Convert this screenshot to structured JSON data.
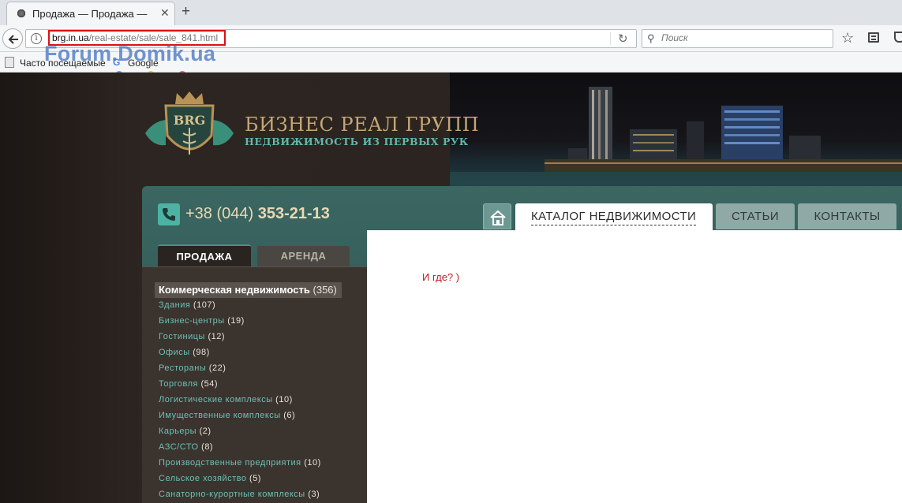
{
  "browser": {
    "tab_title": "Продажа — Продажа — Кат",
    "url_domain": "brg.in.ua",
    "url_path": "/real-estate/sale/sale_841.html",
    "search_placeholder": "Поиск",
    "bookmarks": [
      {
        "label": "Часто посещаемые"
      },
      {
        "label": "Google"
      }
    ],
    "watermark": "Forum.Domik.ua"
  },
  "site": {
    "emblem_text": "BRG",
    "name": "БИЗНЕС РЕАЛ ГРУПП",
    "tagline": "НЕДВИЖИМОСТЬ ИЗ ПЕРВЫХ РУК",
    "phone_prefix": "+38 (044)",
    "phone_number": "353-21-13",
    "sidebar_tabs": {
      "sale": "ПРОДАЖА",
      "rent": "АРЕНДА"
    },
    "nav": {
      "catalog": "КАТАЛОГ НЕДВИЖИМОСТИ",
      "articles": "СТАТЬИ",
      "contacts": "КОНТАКТЫ"
    },
    "category_head": {
      "name": "Коммерческая недвижимость",
      "count": "(356)"
    },
    "categories": [
      {
        "name": "Здания",
        "count": "(107)"
      },
      {
        "name": "Бизнес-центры",
        "count": "(19)"
      },
      {
        "name": "Гостиницы",
        "count": "(12)"
      },
      {
        "name": "Офисы",
        "count": "(98)"
      },
      {
        "name": "Рестораны",
        "count": "(22)"
      },
      {
        "name": "Торговля",
        "count": "(54)"
      },
      {
        "name": "Логистические комплексы",
        "count": "(10)"
      },
      {
        "name": "Имущественные комплексы",
        "count": "(6)"
      },
      {
        "name": "Карьеры",
        "count": "(2)"
      },
      {
        "name": "АЗС/СТО",
        "count": "(8)"
      },
      {
        "name": "Производственные предприятия",
        "count": "(10)"
      },
      {
        "name": "Сельское хозяйство",
        "count": "(5)"
      },
      {
        "name": "Санаторно-курортные комплексы",
        "count": "(3)"
      }
    ],
    "content_message": "И где? )"
  },
  "colors": {
    "accent_teal": "#4db2a4",
    "url_highlight": "#dd1111",
    "message_red": "#c21d1d",
    "gold": "#c6a674"
  }
}
